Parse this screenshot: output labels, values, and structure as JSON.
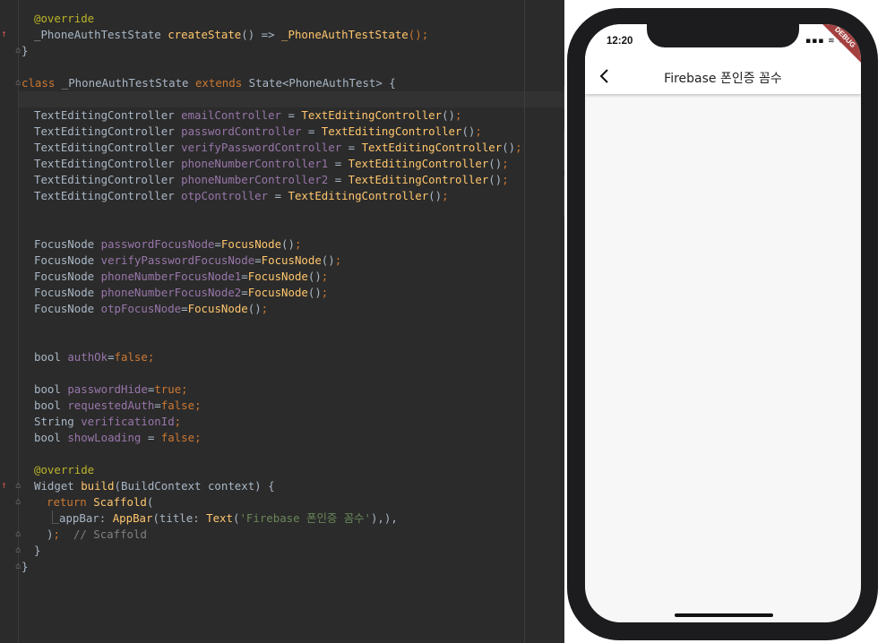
{
  "editor": {
    "lines": [
      [
        [
          "ann",
          "@override"
        ]
      ],
      [
        [
          "t",
          "_PhoneAuthTestState "
        ],
        [
          "fn",
          "createState"
        ],
        [
          "t",
          "() => "
        ],
        [
          "fn",
          "_PhoneAuthTestState"
        ],
        [
          "kw",
          "();"
        ]
      ],
      [
        [
          "t",
          "}"
        ]
      ],
      [],
      [
        [
          "kw",
          "class "
        ],
        [
          "t",
          "_PhoneAuthTestState "
        ],
        [
          "kw",
          "extends "
        ],
        [
          "t",
          "State<PhoneAuthTest> {"
        ]
      ],
      [],
      [
        [
          "t",
          "TextEditingController "
        ],
        [
          "fld",
          "emailController"
        ],
        [
          "t",
          " = "
        ],
        [
          "fn",
          "TextEditingController"
        ],
        [
          "t",
          "()"
        ],
        [
          "kw",
          ";"
        ]
      ],
      [
        [
          "t",
          "TextEditingController "
        ],
        [
          "fld",
          "passwordController"
        ],
        [
          "t",
          " = "
        ],
        [
          "fn",
          "TextEditingController"
        ],
        [
          "t",
          "()"
        ],
        [
          "kw",
          ";"
        ]
      ],
      [
        [
          "t",
          "TextEditingController "
        ],
        [
          "fld",
          "verifyPasswordController"
        ],
        [
          "t",
          " = "
        ],
        [
          "fn",
          "TextEditingController"
        ],
        [
          "t",
          "()"
        ],
        [
          "kw",
          ";"
        ]
      ],
      [
        [
          "t",
          "TextEditingController "
        ],
        [
          "fld",
          "phoneNumberController1"
        ],
        [
          "t",
          " = "
        ],
        [
          "fn",
          "TextEditingController"
        ],
        [
          "t",
          "()"
        ],
        [
          "kw",
          ";"
        ]
      ],
      [
        [
          "t",
          "TextEditingController "
        ],
        [
          "fld",
          "phoneNumberController2"
        ],
        [
          "t",
          " = "
        ],
        [
          "fn",
          "TextEditingController"
        ],
        [
          "t",
          "()"
        ],
        [
          "kw",
          ";"
        ]
      ],
      [
        [
          "t",
          "TextEditingController "
        ],
        [
          "fld",
          "otpController"
        ],
        [
          "t",
          " = "
        ],
        [
          "fn",
          "TextEditingController"
        ],
        [
          "t",
          "()"
        ],
        [
          "kw",
          ";"
        ]
      ],
      [],
      [],
      [
        [
          "t",
          "FocusNode "
        ],
        [
          "fld",
          "passwordFocusNode"
        ],
        [
          "t",
          "="
        ],
        [
          "fn",
          "FocusNode"
        ],
        [
          "t",
          "()"
        ],
        [
          "kw",
          ";"
        ]
      ],
      [
        [
          "t",
          "FocusNode "
        ],
        [
          "fld",
          "verifyPasswordFocusNode"
        ],
        [
          "t",
          "="
        ],
        [
          "fn",
          "FocusNode"
        ],
        [
          "t",
          "()"
        ],
        [
          "kw",
          ";"
        ]
      ],
      [
        [
          "t",
          "FocusNode "
        ],
        [
          "fld",
          "phoneNumberFocusNode1"
        ],
        [
          "t",
          "="
        ],
        [
          "fn",
          "FocusNode"
        ],
        [
          "t",
          "()"
        ],
        [
          "kw",
          ";"
        ]
      ],
      [
        [
          "t",
          "FocusNode "
        ],
        [
          "fld",
          "phoneNumberFocusNode2"
        ],
        [
          "t",
          "="
        ],
        [
          "fn",
          "FocusNode"
        ],
        [
          "t",
          "()"
        ],
        [
          "kw",
          ";"
        ]
      ],
      [
        [
          "t",
          "FocusNode "
        ],
        [
          "fld",
          "otpFocusNode"
        ],
        [
          "t",
          "="
        ],
        [
          "fn",
          "FocusNode"
        ],
        [
          "t",
          "()"
        ],
        [
          "kw",
          ";"
        ]
      ],
      [],
      [],
      [
        [
          "t",
          "bool "
        ],
        [
          "fld",
          "authOk"
        ],
        [
          "t",
          "="
        ],
        [
          "kw",
          "false;"
        ]
      ],
      [],
      [
        [
          "t",
          "bool "
        ],
        [
          "fld",
          "passwordHide"
        ],
        [
          "t",
          "="
        ],
        [
          "kw",
          "true;"
        ]
      ],
      [
        [
          "t",
          "bool "
        ],
        [
          "fld",
          "requestedAuth"
        ],
        [
          "t",
          "="
        ],
        [
          "kw",
          "false;"
        ]
      ],
      [
        [
          "t",
          "String "
        ],
        [
          "fld",
          "verificationId"
        ],
        [
          "kw",
          ";"
        ]
      ],
      [
        [
          "t",
          "bool "
        ],
        [
          "fld",
          "showLoading"
        ],
        [
          "t",
          " = "
        ],
        [
          "kw",
          "false;"
        ]
      ],
      [],
      [
        [
          "ann",
          "@override"
        ]
      ],
      [
        [
          "t",
          "Widget "
        ],
        [
          "fn",
          "build"
        ],
        [
          "t",
          "(BuildContext context) {"
        ]
      ],
      [
        [
          "kw",
          "return "
        ],
        [
          "fn",
          "Scaffold"
        ],
        [
          "t",
          "("
        ]
      ],
      [
        [
          "t",
          "appBar: "
        ],
        [
          "fn",
          "AppBar"
        ],
        [
          "t",
          "(title: "
        ],
        [
          "fn",
          "Text"
        ],
        [
          "t",
          "("
        ],
        [
          "str",
          "'Firebase 폰인증 꼼수'"
        ],
        [
          "t",
          "),),"
        ]
      ],
      [
        [
          "t",
          ")"
        ],
        [
          "kw",
          ";"
        ],
        [
          "cmt",
          "  // Scaffold"
        ]
      ],
      [
        [
          "t",
          "}"
        ]
      ],
      [
        [
          "t",
          "}"
        ]
      ]
    ]
  },
  "phone": {
    "time": "12:20",
    "status_icons": "▪▪▪ ≋ ▬",
    "debug_banner": "DEBUG",
    "appbar_title": "Firebase 폰인증 꼼수"
  }
}
